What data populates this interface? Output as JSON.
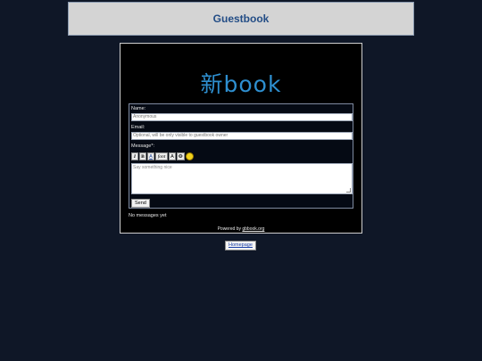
{
  "header": {
    "title": "Guestbook"
  },
  "guestbook": {
    "logo_text": "新book",
    "form": {
      "name_label": "Name:",
      "name_placeholder": "Anonymous",
      "email_label": "Email:",
      "email_placeholder": "Optional, will be only visible to guestbook owner",
      "message_label": "Message*:",
      "message_placeholder": "Say something nice",
      "send_label": "Send",
      "toolbar": {
        "italic": "I",
        "bold": "B",
        "underline": "A",
        "font": "font",
        "size": "A",
        "image": "❂"
      }
    },
    "no_messages": "No messages yet",
    "powered_prefix": "Powered by ",
    "powered_link": "gbbook.org"
  },
  "footer": {
    "homepage_label": "Homepage"
  }
}
